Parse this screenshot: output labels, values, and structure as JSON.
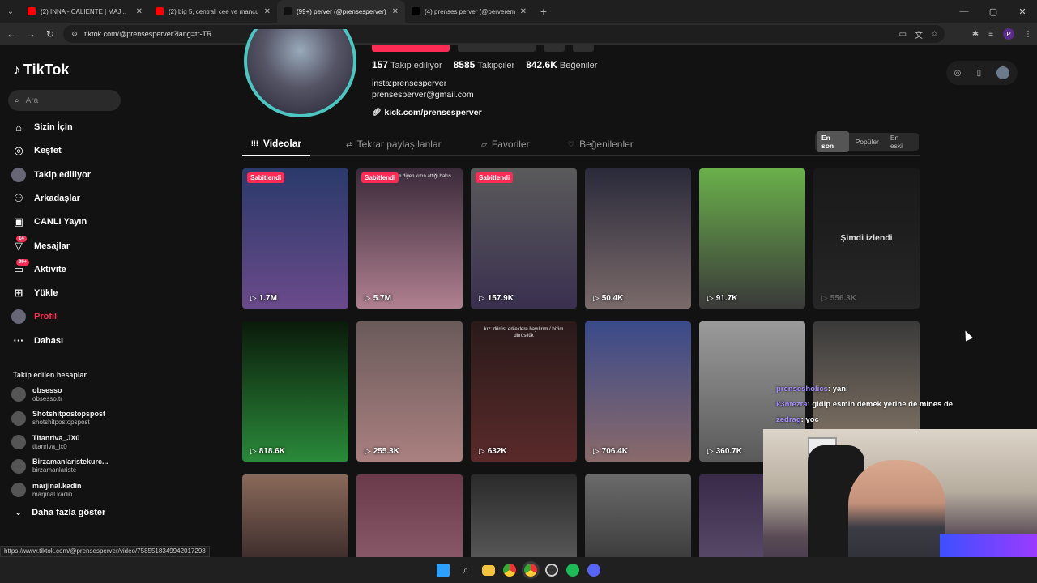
{
  "browser": {
    "tabs": [
      {
        "title": "(2) INNA - CALIENTE | MAJ...",
        "favicon_color": "#ff0000",
        "active": false
      },
      {
        "title": "(2) big 5, centrall cee ve mançu...",
        "favicon_color": "#ff0000",
        "active": false
      },
      {
        "title": "(99+) perver (@prensesperver) |...",
        "favicon_color": "#111111",
        "active": true
      },
      {
        "title": "(4) prenses perver (@perverem...",
        "favicon_color": "#000000",
        "active": false
      }
    ],
    "url": "tiktok.com/@prensesperver?lang=tr-TR",
    "profile_initial": "P"
  },
  "sidebar": {
    "logo_text": "TikTok",
    "search_placeholder": "Ara",
    "nav": [
      {
        "label": "Sizin İçin",
        "icon": "home-icon"
      },
      {
        "label": "Keşfet",
        "icon": "compass-icon"
      },
      {
        "label": "Takip ediliyor",
        "icon": "following-avatar-icon"
      },
      {
        "label": "Arkadaşlar",
        "icon": "friends-icon"
      },
      {
        "label": "CANLI Yayın",
        "icon": "live-icon"
      },
      {
        "label": "Mesajlar",
        "icon": "messages-icon",
        "badge": "14"
      },
      {
        "label": "Aktivite",
        "icon": "activity-icon",
        "badge": "99+"
      },
      {
        "label": "Yükle",
        "icon": "upload-icon"
      },
      {
        "label": "Profil",
        "icon": "profile-avatar-icon"
      },
      {
        "label": "Dahası",
        "icon": "more-dots-icon"
      }
    ],
    "following_title": "Takip edilen hesaplar",
    "following": [
      {
        "name": "obsesso",
        "handle": "obsesso.tr",
        "verified": true
      },
      {
        "name": "Shotshitpostopspost",
        "handle": "shotshitpostopspost"
      },
      {
        "name": "Titanriva_JX0",
        "handle": "titanriva_jx0"
      },
      {
        "name": "Birzamanlaristekurc...",
        "handle": "birzamanlariste"
      },
      {
        "name": "marjinal.kadin",
        "handle": "marjinal.kadin"
      }
    ],
    "show_more": "Daha fazla göster"
  },
  "profile": {
    "stats": [
      {
        "value": "157",
        "label": "Takip ediliyor"
      },
      {
        "value": "8585",
        "label": "Takipçiler"
      },
      {
        "value": "842.6K",
        "label": "Beğeniler"
      }
    ],
    "bio_lines": [
      "insta:prensesperver",
      "prensesperver@gmail.com"
    ],
    "link": "kick.com/prensesperver"
  },
  "tabs": [
    {
      "label": "Videolar",
      "icon": "grid-icon",
      "active": true
    },
    {
      "label": "Tekrar paylaşılanlar",
      "icon": "repost-icon",
      "active": false
    },
    {
      "label": "Favoriler",
      "icon": "bookmark-icon",
      "active": false
    },
    {
      "label": "Beğenilenler",
      "icon": "heart-icon",
      "active": false
    }
  ],
  "sort": [
    "En son",
    "Popüler",
    "En eski"
  ],
  "pinned_label": "Sabitlendi",
  "videos": [
    {
      "views": "1.7M",
      "pinned": true,
      "colors": [
        "#2a3a6a",
        "#6a4a8a"
      ]
    },
    {
      "views": "5.7M",
      "pinned": true,
      "caption": "umut vermedim diyen kızın attığı bakış",
      "colors": [
        "#3a2a3a",
        "#b08090"
      ]
    },
    {
      "views": "157.9K",
      "pinned": true,
      "colors": [
        "#5a5a5a",
        "#3a3050"
      ]
    },
    {
      "views": "50.4K",
      "colors": [
        "#2a2a3a",
        "#7a6a6a"
      ]
    },
    {
      "views": "91.7K",
      "colors": [
        "#6ab04a",
        "#3a3a3a"
      ]
    },
    {
      "views": "556.3K",
      "now_watching": "Şimdi izlendi",
      "colors": [
        "#1a1a1a",
        "#2a2a2a"
      ]
    },
    {
      "views": "818.6K",
      "colors": [
        "#0a1a0a",
        "#2a8a3a"
      ]
    },
    {
      "views": "255.3K",
      "colors": [
        "#6a5a5a",
        "#aa8080"
      ]
    },
    {
      "views": "632K",
      "caption": "kız: dürüst erkeklere bayılırım / bizim dürüstlük",
      "colors": [
        "#2a1a1a",
        "#5a2a2a"
      ]
    },
    {
      "views": "706.4K",
      "colors": [
        "#3a4a8a",
        "#8a6a6a"
      ]
    },
    {
      "views": "360.7K",
      "colors": [
        "#9a9a9a",
        "#5a5a5a"
      ]
    },
    {
      "views": "",
      "colors": [
        "#3a3a3a",
        "#8a7a6a"
      ]
    },
    {
      "views": "",
      "colors": [
        "#8a6a5a",
        "#3a2a2a"
      ]
    },
    {
      "views": "",
      "colors": [
        "#6a3a4a",
        "#8a5a6a"
      ]
    },
    {
      "views": "",
      "colors": [
        "#2a2a2a",
        "#5a5a5a"
      ]
    },
    {
      "views": "",
      "colors": [
        "#6a6a6a",
        "#3a3a3a"
      ]
    },
    {
      "views": "",
      "colors": [
        "#3a2a4a",
        "#5a4a6a"
      ]
    }
  ],
  "chat": [
    {
      "user": "prensesholics",
      "msg": ": yani"
    },
    {
      "user": "k3ntezra",
      "msg": ": gidip esmin demek yerine de mines de"
    },
    {
      "user": "zedrag",
      "msg": ": yoc"
    }
  ],
  "status_url": "https://www.tiktok.com/@prensesperver/video/7585518349942017298"
}
